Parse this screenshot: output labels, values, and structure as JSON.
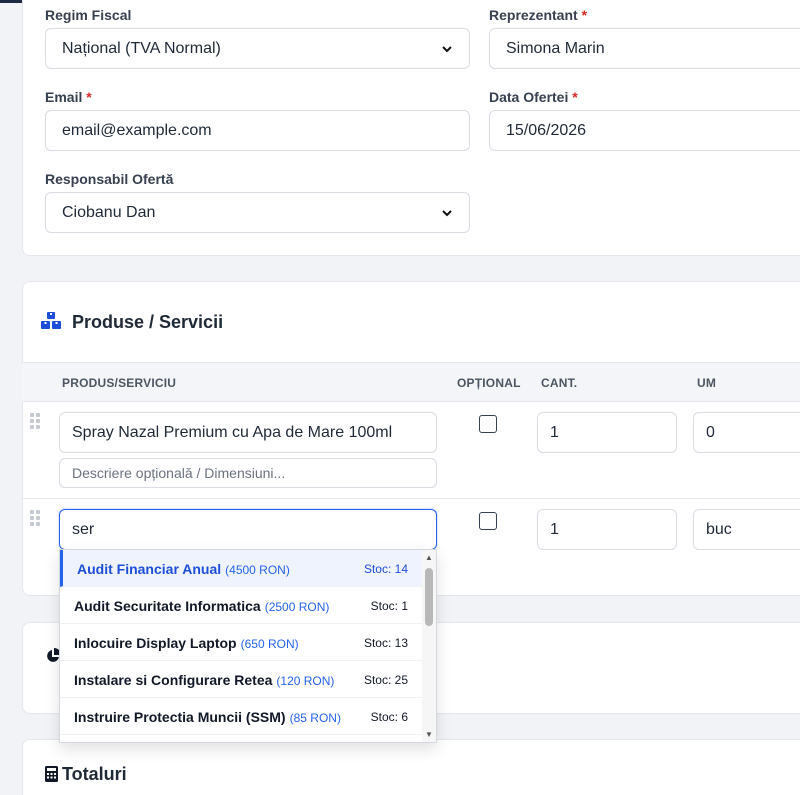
{
  "client": {
    "regim_label": "Regim Fiscal",
    "regim_value": "Național (TVA Normal)",
    "reprezentant_label": "Reprezentant",
    "reprezentant_value": "Simona Marin",
    "email_label": "Email",
    "email_value": "email@example.com",
    "data_label": "Data Ofertei",
    "data_value": "15/06/2026",
    "responsabil_label": "Responsabil Ofertă",
    "responsabil_value": "Ciobanu Dan",
    "required_mark": "*"
  },
  "products": {
    "title": "Produse / Servicii",
    "columns": [
      "PRODUS/SERVICIU",
      "OPȚIONAL",
      "CANT.",
      "UM"
    ],
    "rows": [
      {
        "name": "Spray Nazal Premium cu Apa de Mare 100ml",
        "description_placeholder": "Descriere opțională / Dimensiuni...",
        "qty": "1",
        "um": "0",
        "optional": false
      },
      {
        "name": "ser",
        "qty": "1",
        "um": "buc",
        "optional": false
      }
    ],
    "suggestions": [
      {
        "name": "Audit Financiar Anual",
        "price": "(4500 RON)",
        "stock": "Stoc: 14"
      },
      {
        "name": "Audit Securitate Informatica",
        "price": "(2500 RON)",
        "stock": "Stoc: 1"
      },
      {
        "name": "Inlocuire Display Laptop",
        "price": "(650 RON)",
        "stock": "Stoc: 13"
      },
      {
        "name": "Instalare si Configurare Retea",
        "price": "(120 RON)",
        "stock": "Stoc: 25"
      },
      {
        "name": "Instruire Protectia Muncii (SSM)",
        "price": "(85 RON)",
        "stock": "Stoc: 6"
      }
    ]
  },
  "totals": {
    "title": "Totaluri"
  },
  "colors": {
    "accent": "#2563eb",
    "required": "#dc2626",
    "icon": "#1d4ed8"
  },
  "icons": {
    "products": "boxes-icon",
    "chart": "pie-chart-icon",
    "totals": "calculator-icon"
  }
}
